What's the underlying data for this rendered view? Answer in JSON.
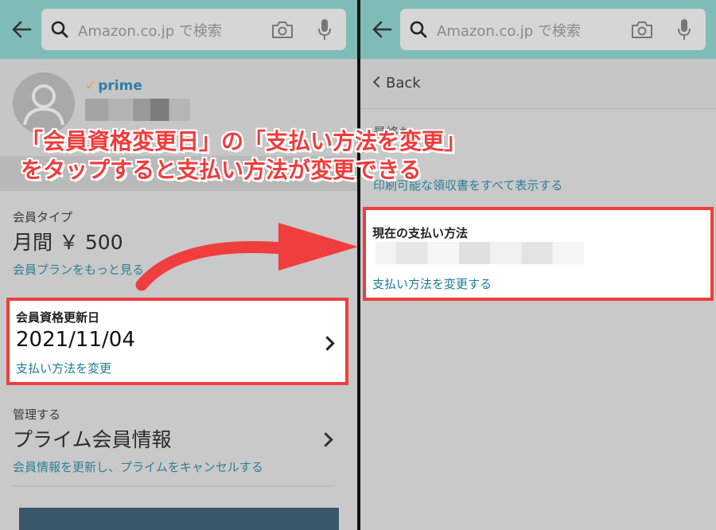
{
  "search": {
    "placeholder": "Amazon.co.jp で検索"
  },
  "left": {
    "prime_badge": "prime",
    "member_type": {
      "label": "会員タイプ",
      "value": "月間 ￥ 500",
      "link": "会員プランをもっと見る"
    },
    "renewal": {
      "label": "会員資格更新日",
      "date": "2021/11/04",
      "link": "支払い方法を変更"
    },
    "manage": {
      "label": "管理する",
      "title": "プライム会員情報",
      "link": "会員情報を更新し、プライムをキャンセルする"
    }
  },
  "right": {
    "back_label": "Back",
    "partial_heading": "最終お",
    "partial_link": "印刷可能な領収書をすべて表示する",
    "payment": {
      "title": "現在の支払い方法",
      "link": "支払い方法を変更する"
    }
  },
  "overlay": {
    "line1": "「会員資格変更日」の「支払い方法を変更」",
    "line2": "をタップすると支払い方法が変更できる"
  },
  "colors": {
    "highlight": "#f03e3e",
    "link": "#1b7c94",
    "header": "#7fbcb7"
  }
}
